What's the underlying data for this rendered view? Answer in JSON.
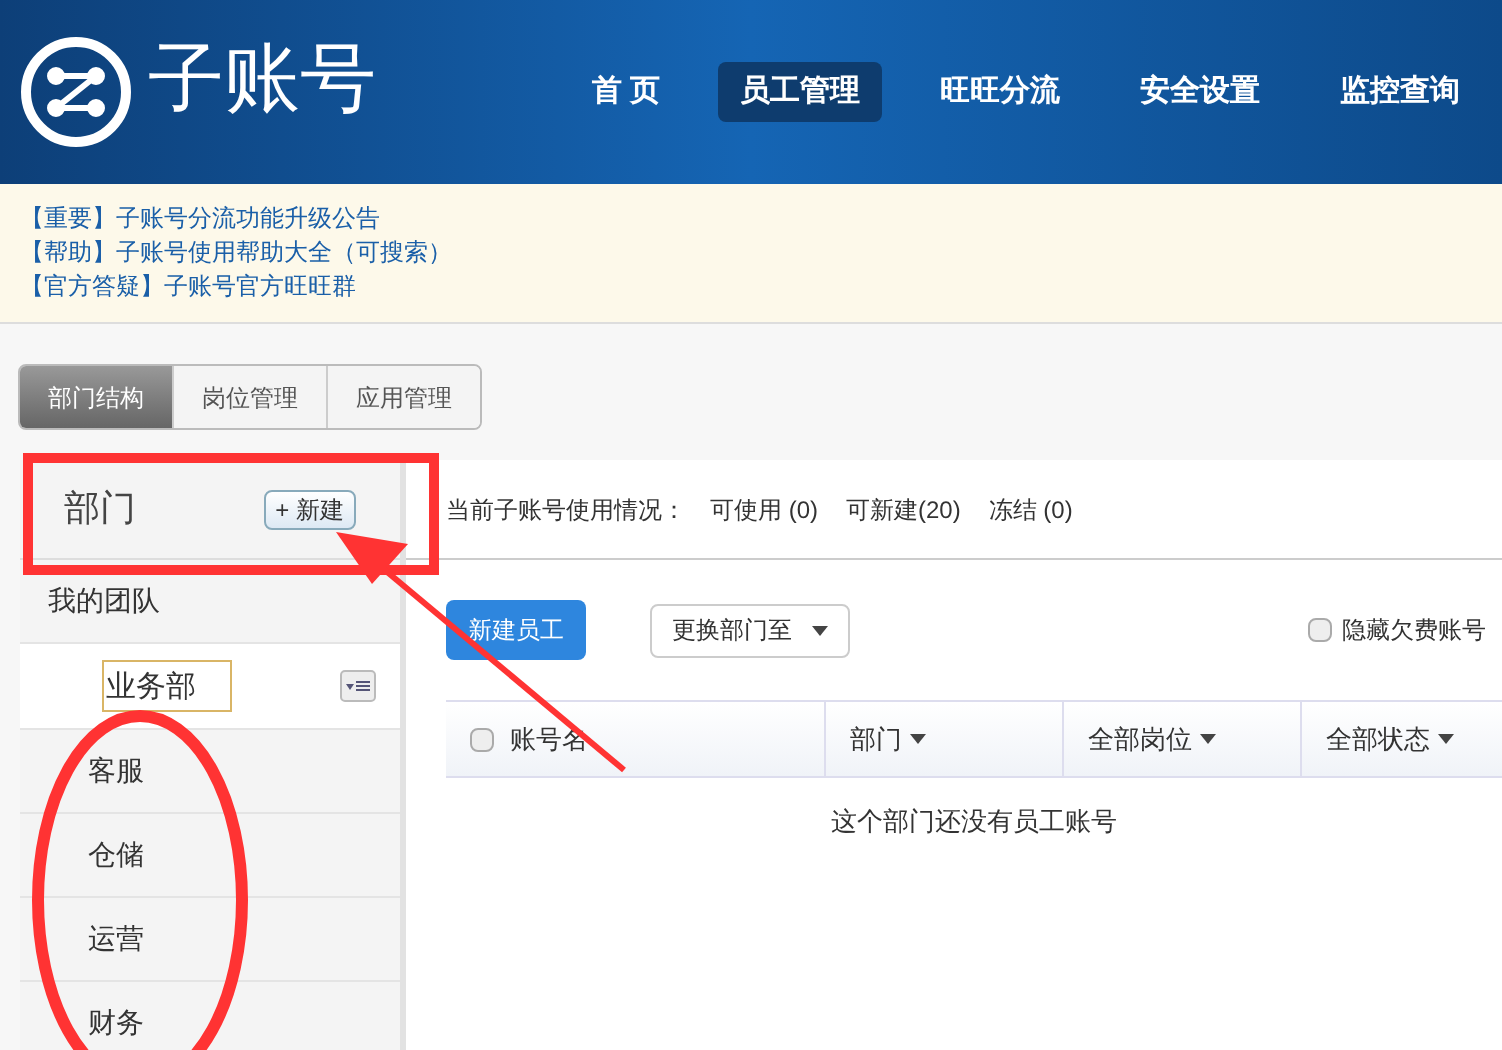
{
  "header": {
    "title": "子账号",
    "nav": [
      {
        "label": "首 页",
        "selected": false
      },
      {
        "label": "员工管理",
        "selected": true
      },
      {
        "label": "旺旺分流",
        "selected": false
      },
      {
        "label": "安全设置",
        "selected": false
      },
      {
        "label": "监控查询",
        "selected": false
      }
    ]
  },
  "notices": [
    {
      "tag": "【重要】",
      "text": "子账号分流功能升级公告"
    },
    {
      "tag": "【帮助】",
      "text": "子账号使用帮助大全（可搜索）"
    },
    {
      "tag": "【官方答疑】",
      "text": "子账号官方旺旺群"
    }
  ],
  "tabs": [
    {
      "label": "部门结构",
      "selected": true
    },
    {
      "label": "岗位管理",
      "selected": false
    },
    {
      "label": "应用管理",
      "selected": false
    }
  ],
  "sidebar": {
    "title": "部门",
    "new_button": "+ 新建",
    "items": [
      {
        "kind": "group",
        "label": "我的团队"
      },
      {
        "kind": "editing",
        "value": "业务部"
      },
      {
        "kind": "item",
        "label": "客服"
      },
      {
        "kind": "item",
        "label": "仓储"
      },
      {
        "kind": "item",
        "label": "运营"
      },
      {
        "kind": "item",
        "label": "财务"
      }
    ]
  },
  "usage": {
    "label": "当前子账号使用情况：",
    "stats": [
      "可使用 (0)",
      "可新建(20)",
      "冻结 (0)"
    ]
  },
  "toolbar": {
    "new_button": "新建员工",
    "move_dropdown": "更换部门至",
    "hide_overdue": {
      "label": "隐藏欠费账号",
      "checked": false
    }
  },
  "table": {
    "columns": [
      {
        "label": "账号名",
        "kind": "checkbox",
        "checked": false
      },
      {
        "label": "部门",
        "kind": "sort"
      },
      {
        "label": "全部岗位",
        "kind": "sort"
      },
      {
        "label": "全部状态",
        "kind": "sort"
      }
    ],
    "empty": "这个部门还没有员工账号"
  }
}
